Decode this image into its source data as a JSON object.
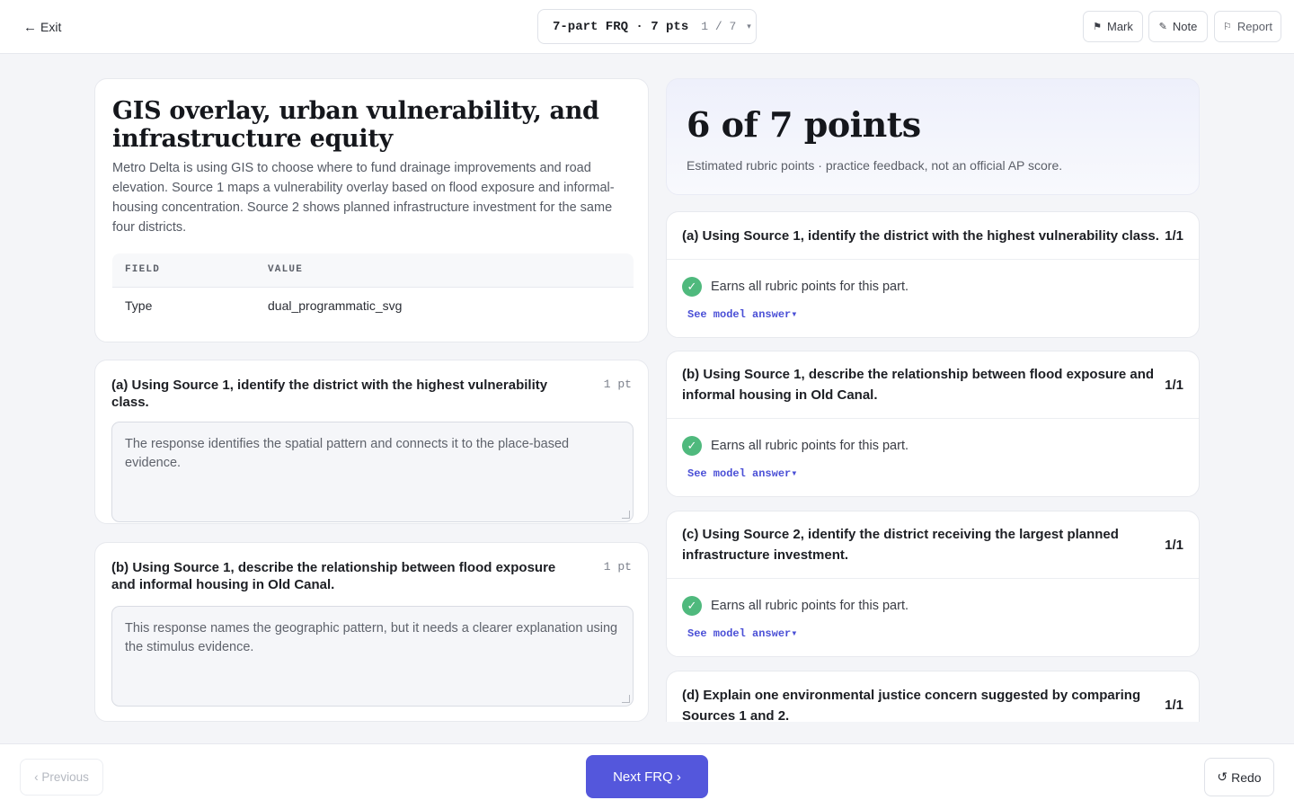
{
  "header": {
    "exit_icon": "←",
    "exit_label": "Exit",
    "frq_title": "7-part FRQ · 7 pts",
    "frq_count": "1 / 7",
    "frq_caret": "▾",
    "mark_icon": "⚑",
    "mark_label": "Mark",
    "note_icon": "✎",
    "note_label": "Note",
    "report_icon": "⚐",
    "report_label": "Report"
  },
  "stimulus": {
    "title": "GIS overlay, urban vulnerability, and infrastructure equity",
    "description": "Metro Delta is using GIS to choose where to fund drainage improvements and road elevation. Source 1 maps a vulnerability overlay based on flood exposure and informal-housing concentration. Source 2 shows planned infrastructure investment for the same four districts.",
    "table": {
      "headers": [
        "FIELD",
        "VALUE"
      ],
      "rows": [
        [
          "Type",
          "dual_programmatic_svg"
        ]
      ]
    }
  },
  "questions": [
    {
      "prompt": "(a) Using Source 1, identify the district with the highest vulnerability class.",
      "points": "1 pt",
      "answer": "The response identifies the spatial pattern and connects it to the place-based evidence."
    },
    {
      "prompt": "(b) Using Source 1, describe the relationship between flood exposure and informal housing in Old Canal.",
      "points": "1 pt",
      "answer": "This response names the geographic pattern, but it needs a clearer explanation using the stimulus evidence."
    }
  ],
  "score": {
    "headline": "6 of 7 points",
    "subtitle": "Estimated rubric points · practice feedback, not an official AP score."
  },
  "feedback": [
    {
      "prompt": "(a) Using Source 1, identify the district with the highest vulnerability class.",
      "score": "1/1",
      "status_icon": "✓",
      "status": "Earns all rubric points for this part.",
      "model_link": "See model answer▾"
    },
    {
      "prompt": "(b) Using Source 1, describe the relationship between flood exposure and informal housing in Old Canal.",
      "score": "1/1",
      "status_icon": "✓",
      "status": "Earns all rubric points for this part.",
      "model_link": "See model answer▾"
    },
    {
      "prompt": "(c) Using Source 2, identify the district receiving the largest planned infrastructure investment.",
      "score": "1/1",
      "status_icon": "✓",
      "status": "Earns all rubric points for this part.",
      "model_link": "See model answer▾"
    },
    {
      "prompt": "(d) Explain one environmental justice concern suggested by comparing Sources 1 and 2.",
      "score": "1/1"
    }
  ],
  "footer": {
    "previous_label": "‹ Previous",
    "next_label": "Next FRQ ›",
    "redo_icon": "↺",
    "redo_label": "Redo"
  },
  "colors": {
    "accent": "#5457dc",
    "success": "#4fb97d",
    "link": "#4a4fd6"
  }
}
